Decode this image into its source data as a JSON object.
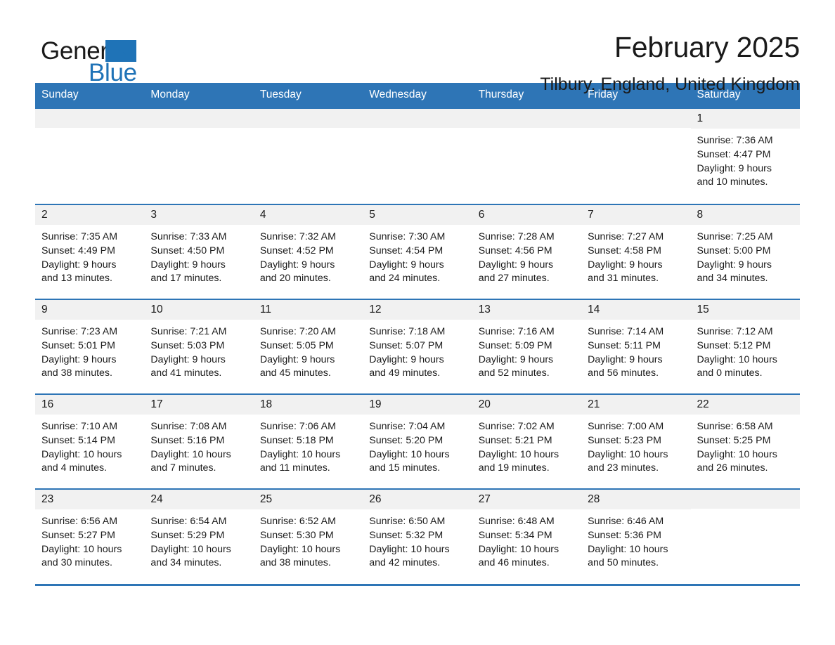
{
  "brand": {
    "name_part1": "General",
    "name_part2": "Blue",
    "logo_icon": "triangle-logo-icon",
    "accent_color": "#1f73b7"
  },
  "header": {
    "title": "February 2025",
    "subtitle": "Tilbury, England, United Kingdom"
  },
  "colors": {
    "header_blue": "#2e75b6",
    "row_divider_blue": "#2e75b6",
    "daynum_band": "#f1f1f1",
    "text": "#1a1a1a"
  },
  "weekday_headers": [
    "Sunday",
    "Monday",
    "Tuesday",
    "Wednesday",
    "Thursday",
    "Friday",
    "Saturday"
  ],
  "weeks": [
    [
      {
        "blank": true
      },
      {
        "blank": true
      },
      {
        "blank": true
      },
      {
        "blank": true
      },
      {
        "blank": true
      },
      {
        "blank": true
      },
      {
        "blank": false,
        "day": "1",
        "sunrise": "Sunrise: 7:36 AM",
        "sunset": "Sunset: 4:47 PM",
        "daylight_line1": "Daylight: 9 hours",
        "daylight_line2": "and 10 minutes."
      }
    ],
    [
      {
        "blank": false,
        "day": "2",
        "sunrise": "Sunrise: 7:35 AM",
        "sunset": "Sunset: 4:49 PM",
        "daylight_line1": "Daylight: 9 hours",
        "daylight_line2": "and 13 minutes."
      },
      {
        "blank": false,
        "day": "3",
        "sunrise": "Sunrise: 7:33 AM",
        "sunset": "Sunset: 4:50 PM",
        "daylight_line1": "Daylight: 9 hours",
        "daylight_line2": "and 17 minutes."
      },
      {
        "blank": false,
        "day": "4",
        "sunrise": "Sunrise: 7:32 AM",
        "sunset": "Sunset: 4:52 PM",
        "daylight_line1": "Daylight: 9 hours",
        "daylight_line2": "and 20 minutes."
      },
      {
        "blank": false,
        "day": "5",
        "sunrise": "Sunrise: 7:30 AM",
        "sunset": "Sunset: 4:54 PM",
        "daylight_line1": "Daylight: 9 hours",
        "daylight_line2": "and 24 minutes."
      },
      {
        "blank": false,
        "day": "6",
        "sunrise": "Sunrise: 7:28 AM",
        "sunset": "Sunset: 4:56 PM",
        "daylight_line1": "Daylight: 9 hours",
        "daylight_line2": "and 27 minutes."
      },
      {
        "blank": false,
        "day": "7",
        "sunrise": "Sunrise: 7:27 AM",
        "sunset": "Sunset: 4:58 PM",
        "daylight_line1": "Daylight: 9 hours",
        "daylight_line2": "and 31 minutes."
      },
      {
        "blank": false,
        "day": "8",
        "sunrise": "Sunrise: 7:25 AM",
        "sunset": "Sunset: 5:00 PM",
        "daylight_line1": "Daylight: 9 hours",
        "daylight_line2": "and 34 minutes."
      }
    ],
    [
      {
        "blank": false,
        "day": "9",
        "sunrise": "Sunrise: 7:23 AM",
        "sunset": "Sunset: 5:01 PM",
        "daylight_line1": "Daylight: 9 hours",
        "daylight_line2": "and 38 minutes."
      },
      {
        "blank": false,
        "day": "10",
        "sunrise": "Sunrise: 7:21 AM",
        "sunset": "Sunset: 5:03 PM",
        "daylight_line1": "Daylight: 9 hours",
        "daylight_line2": "and 41 minutes."
      },
      {
        "blank": false,
        "day": "11",
        "sunrise": "Sunrise: 7:20 AM",
        "sunset": "Sunset: 5:05 PM",
        "daylight_line1": "Daylight: 9 hours",
        "daylight_line2": "and 45 minutes."
      },
      {
        "blank": false,
        "day": "12",
        "sunrise": "Sunrise: 7:18 AM",
        "sunset": "Sunset: 5:07 PM",
        "daylight_line1": "Daylight: 9 hours",
        "daylight_line2": "and 49 minutes."
      },
      {
        "blank": false,
        "day": "13",
        "sunrise": "Sunrise: 7:16 AM",
        "sunset": "Sunset: 5:09 PM",
        "daylight_line1": "Daylight: 9 hours",
        "daylight_line2": "and 52 minutes."
      },
      {
        "blank": false,
        "day": "14",
        "sunrise": "Sunrise: 7:14 AM",
        "sunset": "Sunset: 5:11 PM",
        "daylight_line1": "Daylight: 9 hours",
        "daylight_line2": "and 56 minutes."
      },
      {
        "blank": false,
        "day": "15",
        "sunrise": "Sunrise: 7:12 AM",
        "sunset": "Sunset: 5:12 PM",
        "daylight_line1": "Daylight: 10 hours",
        "daylight_line2": "and 0 minutes."
      }
    ],
    [
      {
        "blank": false,
        "day": "16",
        "sunrise": "Sunrise: 7:10 AM",
        "sunset": "Sunset: 5:14 PM",
        "daylight_line1": "Daylight: 10 hours",
        "daylight_line2": "and 4 minutes."
      },
      {
        "blank": false,
        "day": "17",
        "sunrise": "Sunrise: 7:08 AM",
        "sunset": "Sunset: 5:16 PM",
        "daylight_line1": "Daylight: 10 hours",
        "daylight_line2": "and 7 minutes."
      },
      {
        "blank": false,
        "day": "18",
        "sunrise": "Sunrise: 7:06 AM",
        "sunset": "Sunset: 5:18 PM",
        "daylight_line1": "Daylight: 10 hours",
        "daylight_line2": "and 11 minutes."
      },
      {
        "blank": false,
        "day": "19",
        "sunrise": "Sunrise: 7:04 AM",
        "sunset": "Sunset: 5:20 PM",
        "daylight_line1": "Daylight: 10 hours",
        "daylight_line2": "and 15 minutes."
      },
      {
        "blank": false,
        "day": "20",
        "sunrise": "Sunrise: 7:02 AM",
        "sunset": "Sunset: 5:21 PM",
        "daylight_line1": "Daylight: 10 hours",
        "daylight_line2": "and 19 minutes."
      },
      {
        "blank": false,
        "day": "21",
        "sunrise": "Sunrise: 7:00 AM",
        "sunset": "Sunset: 5:23 PM",
        "daylight_line1": "Daylight: 10 hours",
        "daylight_line2": "and 23 minutes."
      },
      {
        "blank": false,
        "day": "22",
        "sunrise": "Sunrise: 6:58 AM",
        "sunset": "Sunset: 5:25 PM",
        "daylight_line1": "Daylight: 10 hours",
        "daylight_line2": "and 26 minutes."
      }
    ],
    [
      {
        "blank": false,
        "day": "23",
        "sunrise": "Sunrise: 6:56 AM",
        "sunset": "Sunset: 5:27 PM",
        "daylight_line1": "Daylight: 10 hours",
        "daylight_line2": "and 30 minutes."
      },
      {
        "blank": false,
        "day": "24",
        "sunrise": "Sunrise: 6:54 AM",
        "sunset": "Sunset: 5:29 PM",
        "daylight_line1": "Daylight: 10 hours",
        "daylight_line2": "and 34 minutes."
      },
      {
        "blank": false,
        "day": "25",
        "sunrise": "Sunrise: 6:52 AM",
        "sunset": "Sunset: 5:30 PM",
        "daylight_line1": "Daylight: 10 hours",
        "daylight_line2": "and 38 minutes."
      },
      {
        "blank": false,
        "day": "26",
        "sunrise": "Sunrise: 6:50 AM",
        "sunset": "Sunset: 5:32 PM",
        "daylight_line1": "Daylight: 10 hours",
        "daylight_line2": "and 42 minutes."
      },
      {
        "blank": false,
        "day": "27",
        "sunrise": "Sunrise: 6:48 AM",
        "sunset": "Sunset: 5:34 PM",
        "daylight_line1": "Daylight: 10 hours",
        "daylight_line2": "and 46 minutes."
      },
      {
        "blank": false,
        "day": "28",
        "sunrise": "Sunrise: 6:46 AM",
        "sunset": "Sunset: 5:36 PM",
        "daylight_line1": "Daylight: 10 hours",
        "daylight_line2": "and 50 minutes."
      },
      {
        "blank": true
      }
    ]
  ]
}
